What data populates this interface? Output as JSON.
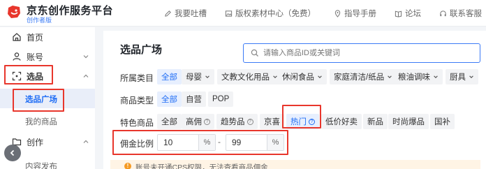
{
  "brand": {
    "title": "京东创作服务平台",
    "subtitle": "创作者版",
    "logo_icon": "jd-dog-logo"
  },
  "toplinks": [
    {
      "label": "我要吐槽",
      "icon": "pen-icon"
    },
    {
      "label": "版权素材中心（免费）",
      "icon": "image-icon"
    },
    {
      "label": "指导手册",
      "icon": "location-pin-icon"
    },
    {
      "label": "论坛",
      "icon": "book-icon"
    },
    {
      "label": "联系客服",
      "icon": "headset-icon"
    }
  ],
  "sidebar": {
    "items": [
      {
        "label": "首页",
        "icon": "home-icon"
      },
      {
        "label": "账号",
        "icon": "user-icon"
      },
      {
        "label": "选品",
        "icon": "scan-icon"
      },
      {
        "label": "选品广场",
        "active": true
      },
      {
        "label": "我的商品"
      },
      {
        "label": "创作",
        "icon": "folder-icon"
      },
      {
        "label": "内容发布"
      }
    ]
  },
  "main": {
    "title": "选品广场",
    "search_placeholder": "请输入商品ID或关键词",
    "filters": {
      "category": {
        "label": "所属类目",
        "options": [
          "全部",
          "母婴",
          "文教文化用品",
          "休闲食品",
          "家庭清洁/纸品",
          "粮油调味",
          "厨具"
        ]
      },
      "type": {
        "label": "商品类型",
        "options": [
          "全部",
          "自营",
          "POP"
        ]
      },
      "feature": {
        "label": "特色商品",
        "options": [
          "全部",
          "高佣",
          "趋势品",
          "京喜",
          "热门",
          "低价好卖",
          "新品",
          "时尚爆品",
          "国补"
        ]
      },
      "commission": {
        "label": "佣金比例",
        "min": "10",
        "max": "99",
        "unit": "%",
        "separator": "-"
      }
    },
    "notice": "账号未开通CPS权限，无法查看商品佣金"
  },
  "colors": {
    "accent": "#1f6df5",
    "highlight": "#e8362c",
    "warning": "#f59a23"
  }
}
